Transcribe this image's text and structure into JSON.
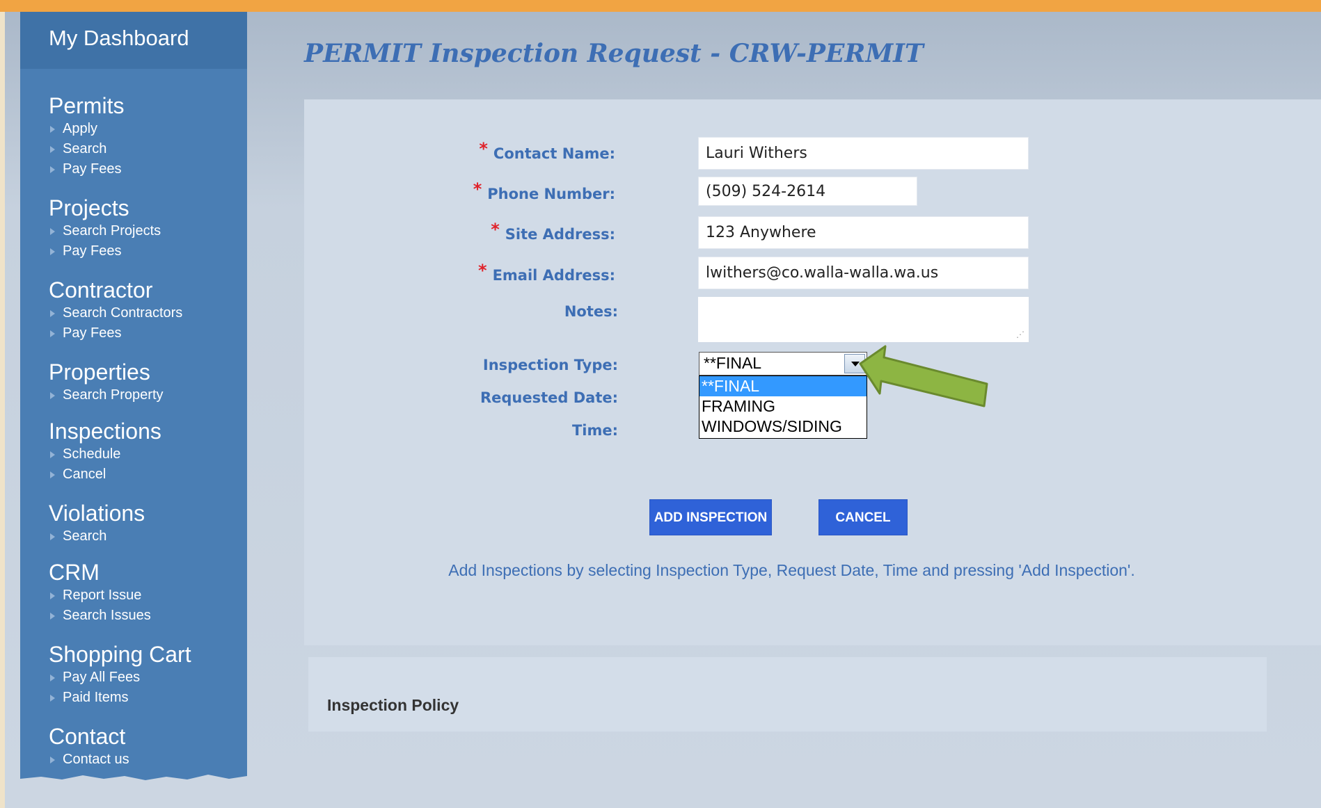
{
  "sidebar": {
    "header": "My Dashboard",
    "sections": [
      {
        "title": "Permits",
        "links": [
          "Apply",
          "Search",
          "Pay Fees"
        ]
      },
      {
        "title": "Projects",
        "links": [
          "Search Projects",
          "Pay Fees"
        ]
      },
      {
        "title": "Contractor",
        "links": [
          "Search Contractors",
          "Pay Fees"
        ]
      },
      {
        "title": "Properties",
        "links": [
          "Search Property"
        ]
      },
      {
        "title": "Inspections",
        "links": [
          "Schedule",
          "Cancel"
        ]
      },
      {
        "title": "Violations",
        "links": [
          "Search"
        ]
      },
      {
        "title": "CRM",
        "links": [
          "Report Issue",
          "Search Issues"
        ]
      },
      {
        "title": "Shopping Cart",
        "links": [
          "Pay All Fees",
          "Paid Items"
        ]
      },
      {
        "title": "Contact",
        "links": [
          "Contact us"
        ]
      }
    ]
  },
  "page": {
    "title": "PERMIT Inspection Request - CRW-PERMIT"
  },
  "form": {
    "contact_name_label": "Contact Name:",
    "contact_name_value": "Lauri Withers",
    "phone_label": "Phone Number:",
    "phone_value": "(509) 524-2614",
    "site_address_label": "Site Address:",
    "site_address_value": "123 Anywhere",
    "email_label": "Email Address:",
    "email_value": "lwithers@co.walla-walla.wa.us",
    "notes_label": "Notes:",
    "inspection_type_label": "Inspection Type:",
    "inspection_type_selected": "**FINAL",
    "inspection_type_options": [
      "**FINAL",
      "FRAMING",
      "WINDOWS/SIDING"
    ],
    "requested_date_label": "Requested Date:",
    "time_label": "Time:",
    "required_marker": "*"
  },
  "buttons": {
    "add_inspection": "ADD INSPECTION",
    "cancel": "CANCEL"
  },
  "hint": "Add Inspections by selecting Inspection Type, Request Date, Time and pressing 'Add Inspection'.",
  "policy": {
    "title": "Inspection Policy"
  },
  "colors": {
    "accent_stripe": "#f1a443",
    "sidebar": "#4a7eb4",
    "label_blue": "#3d6eb4",
    "button_blue": "#2f62d8",
    "required_red": "#e0222a",
    "callout_arrow": "#8db543"
  }
}
